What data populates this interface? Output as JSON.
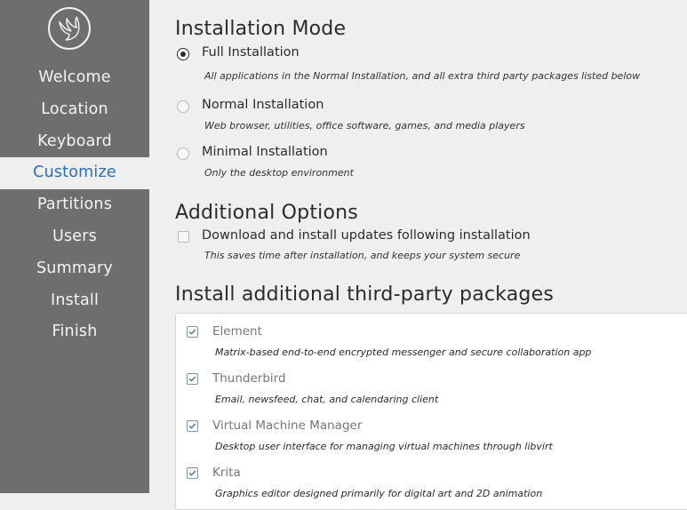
{
  "sidebar": {
    "logo_icon": "bird-logo-icon",
    "items": [
      {
        "label": "Welcome"
      },
      {
        "label": "Location"
      },
      {
        "label": "Keyboard"
      },
      {
        "label": "Customize",
        "active": true
      },
      {
        "label": "Partitions"
      },
      {
        "label": "Users"
      },
      {
        "label": "Summary"
      },
      {
        "label": "Install"
      },
      {
        "label": "Finish"
      }
    ],
    "active_color": "#2a6fb4",
    "background": "#6e6e6e"
  },
  "installation_mode": {
    "title": "Installation Mode",
    "options": [
      {
        "label": "Full Installation",
        "desc": "All applications in the Normal Installation, and all extra third party packages listed below",
        "selected": true
      },
      {
        "label": "Normal Installation",
        "desc": "Web browser, utilities, office software, games, and media players",
        "selected": false
      },
      {
        "label": "Minimal Installation",
        "desc": "Only the desktop environment",
        "selected": false
      }
    ]
  },
  "additional_options": {
    "title": "Additional Options",
    "updates": {
      "label": "Download and install updates following installation",
      "desc": "This saves time after installation, and keeps your system secure",
      "checked": false
    }
  },
  "third_party": {
    "title": "Install additional third-party packages",
    "packages": [
      {
        "name": "Element",
        "desc": "Matrix-based end-to-end encrypted messenger and secure collaboration app",
        "checked": true
      },
      {
        "name": "Thunderbird",
        "desc": "Email, newsfeed, chat, and calendaring client",
        "checked": true
      },
      {
        "name": "Virtual Machine Manager",
        "desc": "Desktop user interface for managing virtual machines through libvirt",
        "checked": true
      },
      {
        "name": "Krita",
        "desc": "Graphics editor designed primarily for digital art and 2D animation",
        "checked": true
      }
    ]
  }
}
